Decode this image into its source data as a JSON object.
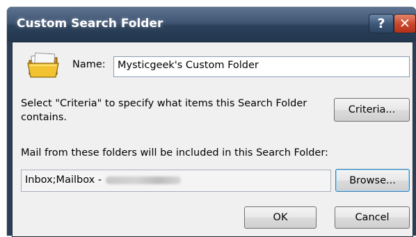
{
  "window": {
    "title": "Custom Search Folder",
    "help_label": "?",
    "close_label": "✕"
  },
  "name_field": {
    "label": "Name:",
    "value": "Mysticgeek's Custom Folder"
  },
  "criteria": {
    "description": "Select \"Criteria\" to specify what items this Search Folder contains.",
    "button_label": "Criteria..."
  },
  "folders": {
    "description": "Mail from these folders will be included in this Search Folder:",
    "value": "Inbox;Mailbox -",
    "button_label": "Browse..."
  },
  "footer": {
    "ok_label": "OK",
    "cancel_label": "Cancel"
  },
  "icons": {
    "folder": "search-folder-icon"
  }
}
